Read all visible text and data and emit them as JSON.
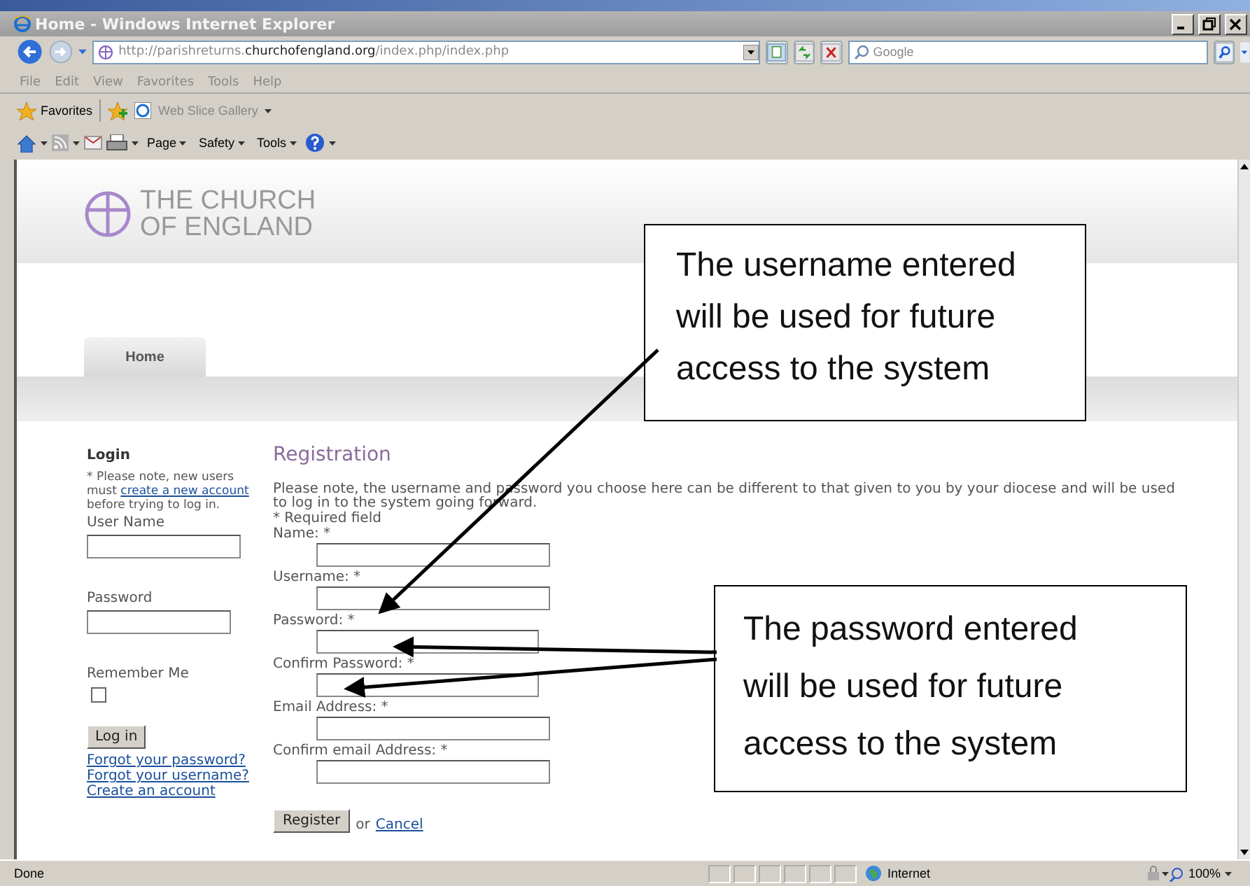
{
  "window": {
    "title": "Home - Windows Internet Explorer"
  },
  "address_bar": {
    "url": "http://parishreturns.**churchofengland.org**/index.php/index.php"
  },
  "search": {
    "placeholder": "Google"
  },
  "menu": [
    "File",
    "Edit",
    "View",
    "Favorites",
    "Tools",
    "Help"
  ],
  "favorites_bar": {
    "label": "Favorites",
    "items": [
      "Web Slice Gallery"
    ]
  },
  "command_bar": [
    "Page",
    "Safety",
    "Tools"
  ],
  "site": {
    "logo": [
      "THE CHURCH",
      "OF ENGLAND"
    ],
    "nav": [
      {
        "label": "Home",
        "selected": true
      }
    ]
  },
  "login": {
    "title": "Login",
    "note_before": "* Please note, new users must",
    "note_link": "create a new account",
    "note_after": "before trying to log in.",
    "fields": [
      {
        "kind": "text",
        "label": "User Name"
      },
      {
        "kind": "text",
        "label": "Password"
      },
      {
        "kind": "checkbox",
        "label": "Remember Me",
        "checked": false
      }
    ],
    "button": "Log in",
    "links": [
      "Forgot your password?",
      "Forgot your username?",
      "Create an account"
    ]
  },
  "registration": {
    "title": "Registration",
    "intro": "Please note, the username and password you choose here can be different to that given to you by your diocese and will be used to log in to the system going forward.",
    "required_note": "* Required field",
    "fields": [
      {
        "kind": "text",
        "label": "Name: *"
      },
      {
        "kind": "text",
        "label": "Username: *"
      },
      {
        "kind": "password",
        "label": "Password: *"
      },
      {
        "kind": "password",
        "label": "Confirm Password: *"
      },
      {
        "kind": "text",
        "label": "Email Address: *"
      },
      {
        "kind": "text",
        "label": "Confirm email Address: *"
      }
    ],
    "button": "Register",
    "or": "or",
    "cancel": "Cancel"
  },
  "callouts": [
    {
      "text": "The username entered will be used for future access to the system"
    },
    {
      "text": "The password entered will be used for future access to the system"
    }
  ],
  "status_bar": {
    "text": "Done",
    "zone": "Internet",
    "zoom": "100%"
  }
}
